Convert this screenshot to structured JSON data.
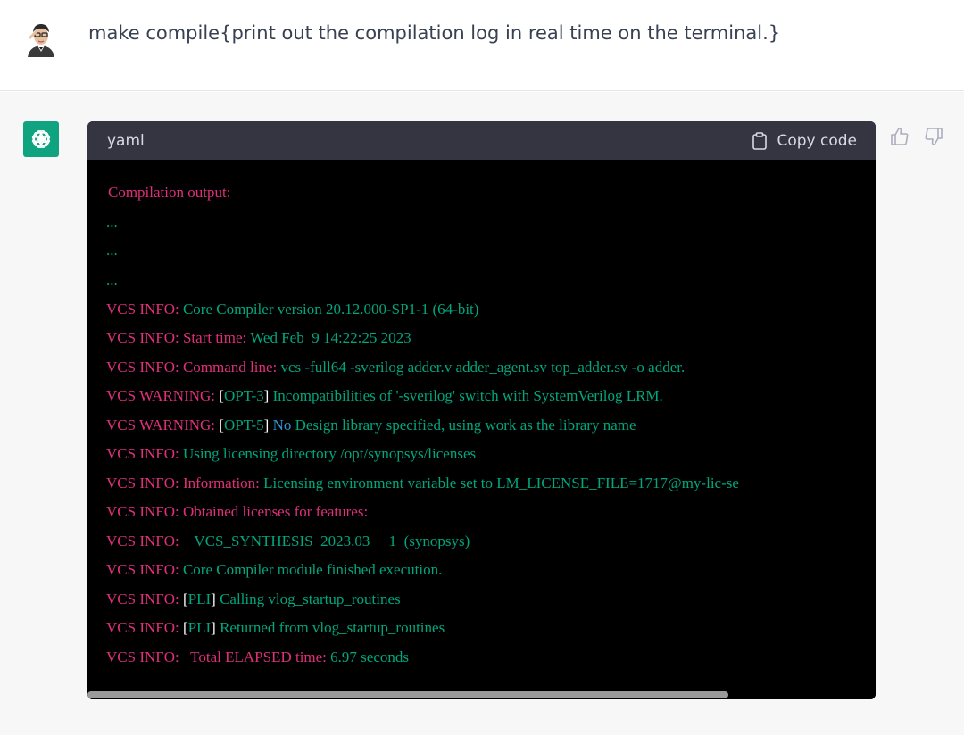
{
  "user_message": {
    "text": "make compile{print out the compilation log in real time on the terminal.}"
  },
  "code_block": {
    "language": "yaml",
    "copy_label": "Copy code",
    "lines": [
      [
        {
          "t": "Compilation output:",
          "c": "#df3079"
        }
      ],
      [
        {
          "t": "...",
          "c": "#00a67d"
        }
      ],
      [
        {
          "t": "...",
          "c": "#00a67d"
        }
      ],
      [
        {
          "t": "...",
          "c": "#00a67d"
        }
      ],
      [
        {
          "t": "VCS INFO: ",
          "c": "#df3079"
        },
        {
          "t": "Core Compiler version 20.12.000-SP1-1 (64-bit)",
          "c": "#00a67d"
        }
      ],
      [
        {
          "t": "VCS INFO: ",
          "c": "#df3079"
        },
        {
          "t": "Start time: ",
          "c": "#df3079"
        },
        {
          "t": "Wed Feb  9 14:22:25 2023",
          "c": "#00a67d"
        }
      ],
      [
        {
          "t": "VCS INFO: ",
          "c": "#df3079"
        },
        {
          "t": "Command line: ",
          "c": "#df3079"
        },
        {
          "t": "vcs -full64 -sverilog adder.v adder_agent.sv top_adder.sv -o adder.",
          "c": "#00a67d"
        }
      ],
      [
        {
          "t": "VCS WARNING: ",
          "c": "#df3079"
        },
        {
          "t": "[",
          "c": "#ffffff"
        },
        {
          "t": "OPT-3",
          "c": "#00a67d"
        },
        {
          "t": "]",
          "c": "#ffffff"
        },
        {
          "t": " Incompatibilities of '-sverilog' switch with SystemVerilog LRM.",
          "c": "#00a67d"
        }
      ],
      [
        {
          "t": "VCS WARNING: ",
          "c": "#df3079"
        },
        {
          "t": "[",
          "c": "#ffffff"
        },
        {
          "t": "OPT-5",
          "c": "#00a67d"
        },
        {
          "t": "]",
          "c": "#ffffff"
        },
        {
          "t": " ",
          "c": "#00a67d"
        },
        {
          "t": "No",
          "c": "#2e95d3"
        },
        {
          "t": " Design library specified, using work as the library name",
          "c": "#00a67d"
        }
      ],
      [
        {
          "t": "VCS INFO: ",
          "c": "#df3079"
        },
        {
          "t": "Using licensing directory /opt/synopsys/licenses",
          "c": "#00a67d"
        }
      ],
      [
        {
          "t": "VCS INFO: ",
          "c": "#df3079"
        },
        {
          "t": "Information: ",
          "c": "#df3079"
        },
        {
          "t": "Licensing environment variable set to LM_LICENSE_FILE=1717@my-lic-se",
          "c": "#00a67d"
        }
      ],
      [
        {
          "t": "VCS INFO: ",
          "c": "#df3079"
        },
        {
          "t": "Obtained licenses for features:",
          "c": "#df3079"
        }
      ],
      [
        {
          "t": "VCS INFO: ",
          "c": "#df3079"
        },
        {
          "t": "   VCS_SYNTHESIS  2023.03     1  (synopsys)",
          "c": "#00a67d"
        }
      ],
      [
        {
          "t": "VCS INFO: ",
          "c": "#df3079"
        },
        {
          "t": "Core Compiler module finished execution.",
          "c": "#00a67d"
        }
      ],
      [
        {
          "t": "VCS INFO: ",
          "c": "#df3079"
        },
        {
          "t": "[",
          "c": "#ffffff"
        },
        {
          "t": "PLI",
          "c": "#00a67d"
        },
        {
          "t": "]",
          "c": "#ffffff"
        },
        {
          "t": " Calling vlog_startup_routines",
          "c": "#00a67d"
        }
      ],
      [
        {
          "t": "VCS INFO: ",
          "c": "#df3079"
        },
        {
          "t": "[",
          "c": "#ffffff"
        },
        {
          "t": "PLI",
          "c": "#00a67d"
        },
        {
          "t": "]",
          "c": "#ffffff"
        },
        {
          "t": " Returned from vlog_startup_routines",
          "c": "#00a67d"
        }
      ],
      [
        {
          "t": "VCS INFO: ",
          "c": "#df3079"
        },
        {
          "t": "  Total ELAPSED time: ",
          "c": "#df3079"
        },
        {
          "t": "6.97 seconds",
          "c": "#00a67d"
        }
      ]
    ]
  },
  "feedback": {
    "thumbs_up": "thumbs-up-icon",
    "thumbs_down": "thumbs-down-icon"
  }
}
